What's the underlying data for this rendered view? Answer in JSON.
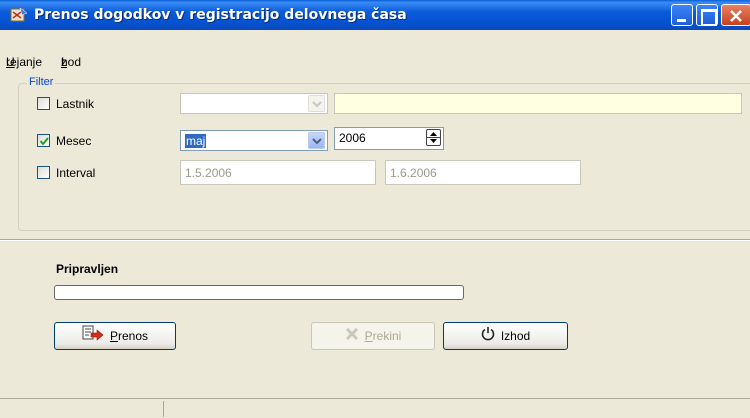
{
  "window": {
    "title": "Prenos dogodkov v registracijo delovnega časa",
    "icon": "app-icon"
  },
  "menu": {
    "items": [
      {
        "accel": "U",
        "rest": "rejanje"
      },
      {
        "pre": "I",
        "accel": "z",
        "rest": "hod"
      }
    ]
  },
  "filter": {
    "legend": "Filter",
    "owner": {
      "label": "Lastnik",
      "checked": false,
      "value": "",
      "text": ""
    },
    "month": {
      "label": "Mesec",
      "checked": true,
      "value": "maj",
      "year": "2006"
    },
    "interval": {
      "label": "Interval",
      "checked": false,
      "from": "1.5.2006",
      "to": "1.6.2006"
    }
  },
  "status": {
    "label": "Pripravljen",
    "progress": 0
  },
  "buttons": {
    "transfer": {
      "accel": "P",
      "rest": "renos",
      "enabled": true
    },
    "cancel": {
      "accel": "P",
      "rest": "rekini",
      "enabled": false
    },
    "exit": {
      "label": "Izhod",
      "enabled": true
    }
  },
  "colors": {
    "titlebar": "#0551cf",
    "accent": "#316ac5",
    "legend": "#0046d5",
    "owner_field": "#ffffe1"
  }
}
